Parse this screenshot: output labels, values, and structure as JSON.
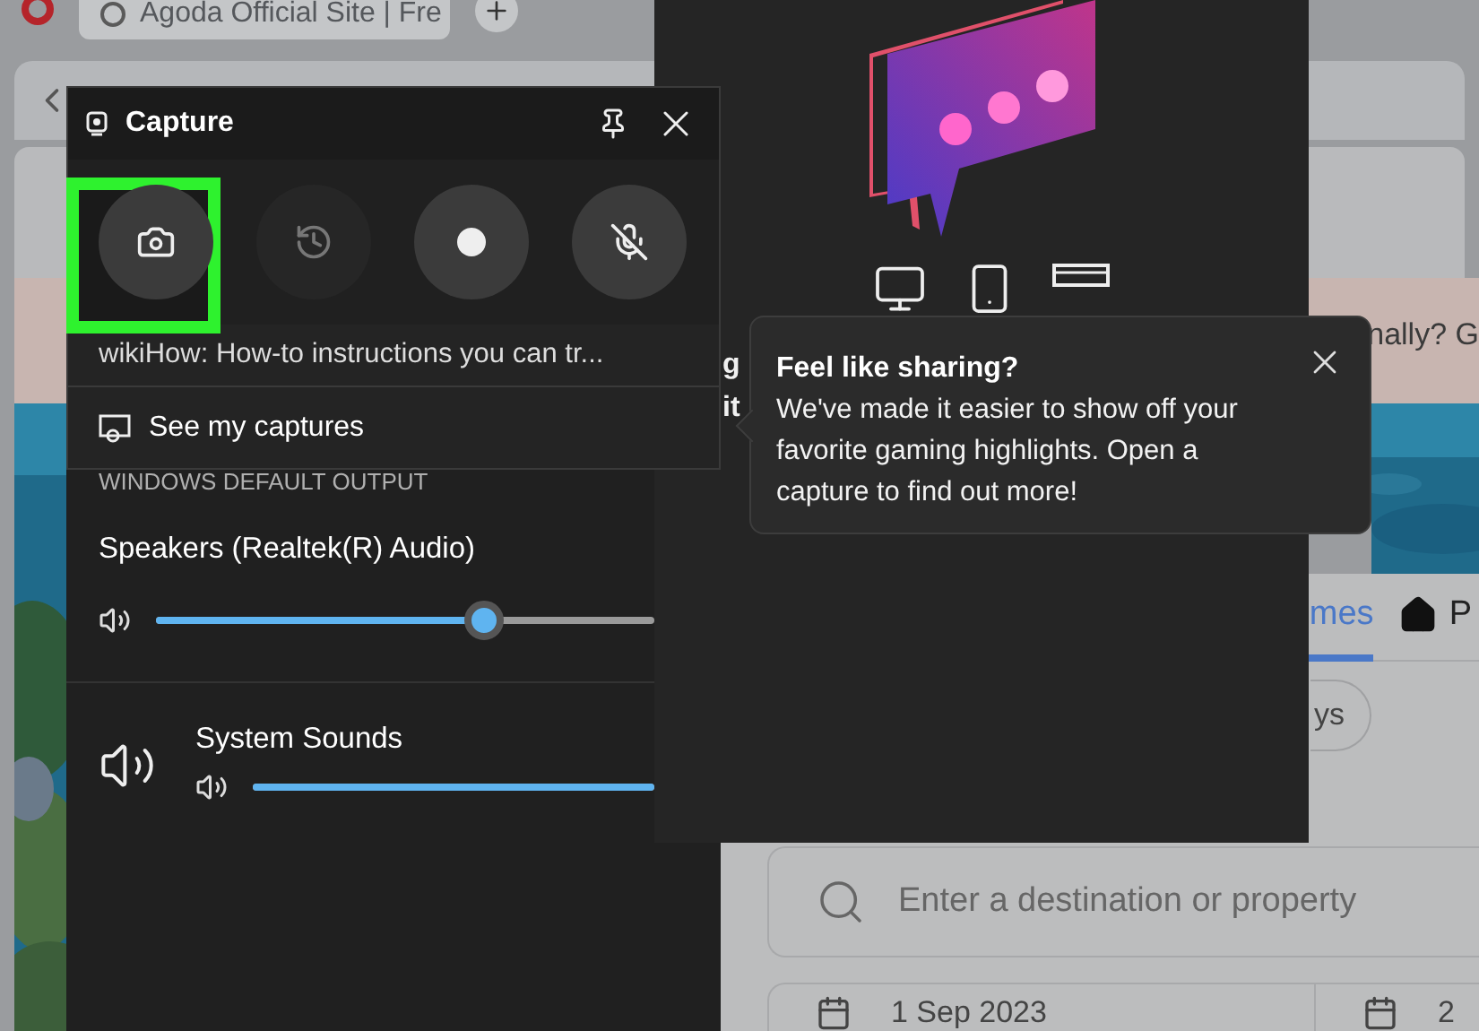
{
  "browser": {
    "tab_title": "Agoda Official Site | Fre"
  },
  "page": {
    "banner_text": "nally? G",
    "tabs": [
      {
        "label": "mes",
        "selected": true
      },
      {
        "label": "P",
        "selected": false
      }
    ],
    "chip": "ys",
    "search": {
      "placeholder": "Enter a destination or property"
    },
    "dates": [
      "1 Sep 2023",
      "2"
    ]
  },
  "share_panel": {
    "text_fragments": [
      "g",
      "it"
    ]
  },
  "capture": {
    "title": "Capture",
    "buttons": [
      {
        "kind": "screenshot",
        "highlighted": true,
        "disabled": false
      },
      {
        "kind": "replay",
        "highlighted": false,
        "disabled": true
      },
      {
        "kind": "record",
        "highlighted": false,
        "disabled": false
      },
      {
        "kind": "mic-off",
        "highlighted": false,
        "disabled": false
      }
    ],
    "source_title": "wikiHow: How-to instructions you can tr...",
    "link": "See my captures"
  },
  "audio": {
    "section": "WINDOWS DEFAULT OUTPUT",
    "device": {
      "name": "Speakers (Realtek(R) Audio)",
      "level": 0.66
    },
    "apps": [
      {
        "name": "System Sounds",
        "level": 1
      }
    ]
  },
  "tooltip": {
    "title": "Feel like sharing?",
    "body": "We've made it easier to show off your favorite gaming highlights. Open a capture to find out more!"
  }
}
